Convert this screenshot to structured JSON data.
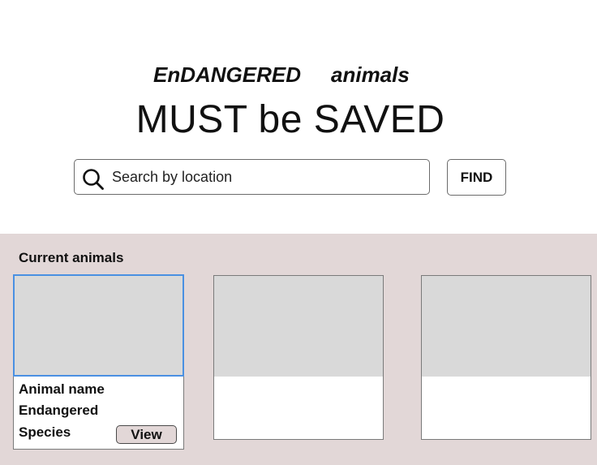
{
  "header": {
    "tagline_word_1": "EnDANGERED",
    "tagline_word_2": "animals",
    "headline": "MUST be SAVED"
  },
  "search": {
    "placeholder": "Search by location",
    "value": "",
    "icon": "search-icon",
    "find_label": "FIND"
  },
  "current_animals": {
    "title": "Current animals",
    "cards": [
      {
        "name": "Animal name",
        "status": "Endangered",
        "species": "Species",
        "view_label": "View",
        "selected": true
      },
      {},
      {}
    ]
  },
  "colors": {
    "section_background": "#e2d7d7",
    "image_placeholder": "#d9d9d9",
    "selection_outline": "#4a90e2",
    "border": "#6b6b6b"
  }
}
